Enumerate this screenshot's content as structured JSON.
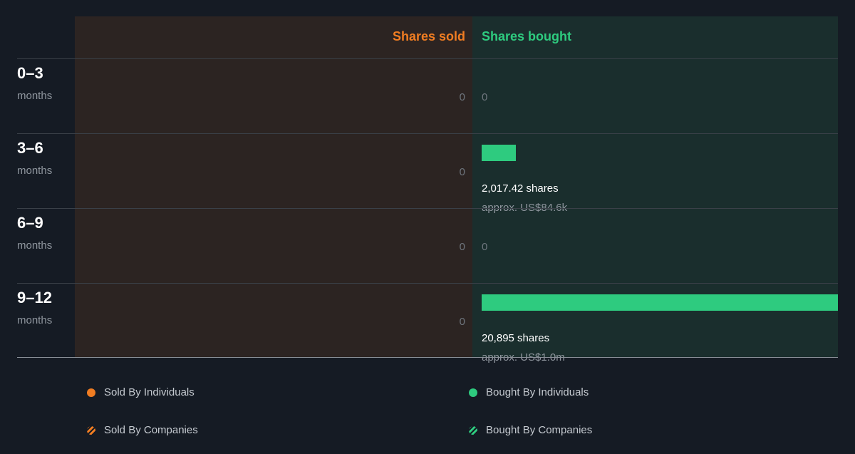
{
  "chart_data": {
    "type": "bar",
    "columns": {
      "sold": "Shares sold",
      "bought": "Shares bought"
    },
    "categories": [
      {
        "range": "0–3",
        "unit": "months"
      },
      {
        "range": "3–6",
        "unit": "months"
      },
      {
        "range": "6–9",
        "unit": "months"
      },
      {
        "range": "9–12",
        "unit": "months"
      }
    ],
    "series": [
      {
        "name": "Shares sold",
        "values": [
          0,
          0,
          0,
          0
        ]
      },
      {
        "name": "Shares bought",
        "values": [
          0,
          2017.42,
          0,
          20895
        ]
      }
    ],
    "bought_labels": [
      {
        "shares": "0",
        "approx": ""
      },
      {
        "shares": "2,017.42 shares",
        "approx": "approx. US$84.6k"
      },
      {
        "shares": "0",
        "approx": ""
      },
      {
        "shares": "20,895 shares",
        "approx": "approx. US$1.0m"
      }
    ],
    "sold_labels": [
      "0",
      "0",
      "0",
      "0"
    ],
    "max_value": 20895,
    "legend": [
      {
        "label": "Sold By Individuals",
        "marker": "dot",
        "color": "#f07d22"
      },
      {
        "label": "Bought By Individuals",
        "marker": "dot",
        "color": "#2ecb7f"
      },
      {
        "label": "Sold By Companies",
        "marker": "stripe",
        "color": "#f07d22"
      },
      {
        "label": "Bought By Companies",
        "marker": "stripe",
        "color": "#2ecb7f"
      }
    ],
    "colors": {
      "sold": "#f07d22",
      "bought": "#2ecb7f",
      "sold_panel": "#2c2422",
      "bought_panel": "#1a2e2d",
      "background": "#151b24"
    }
  }
}
